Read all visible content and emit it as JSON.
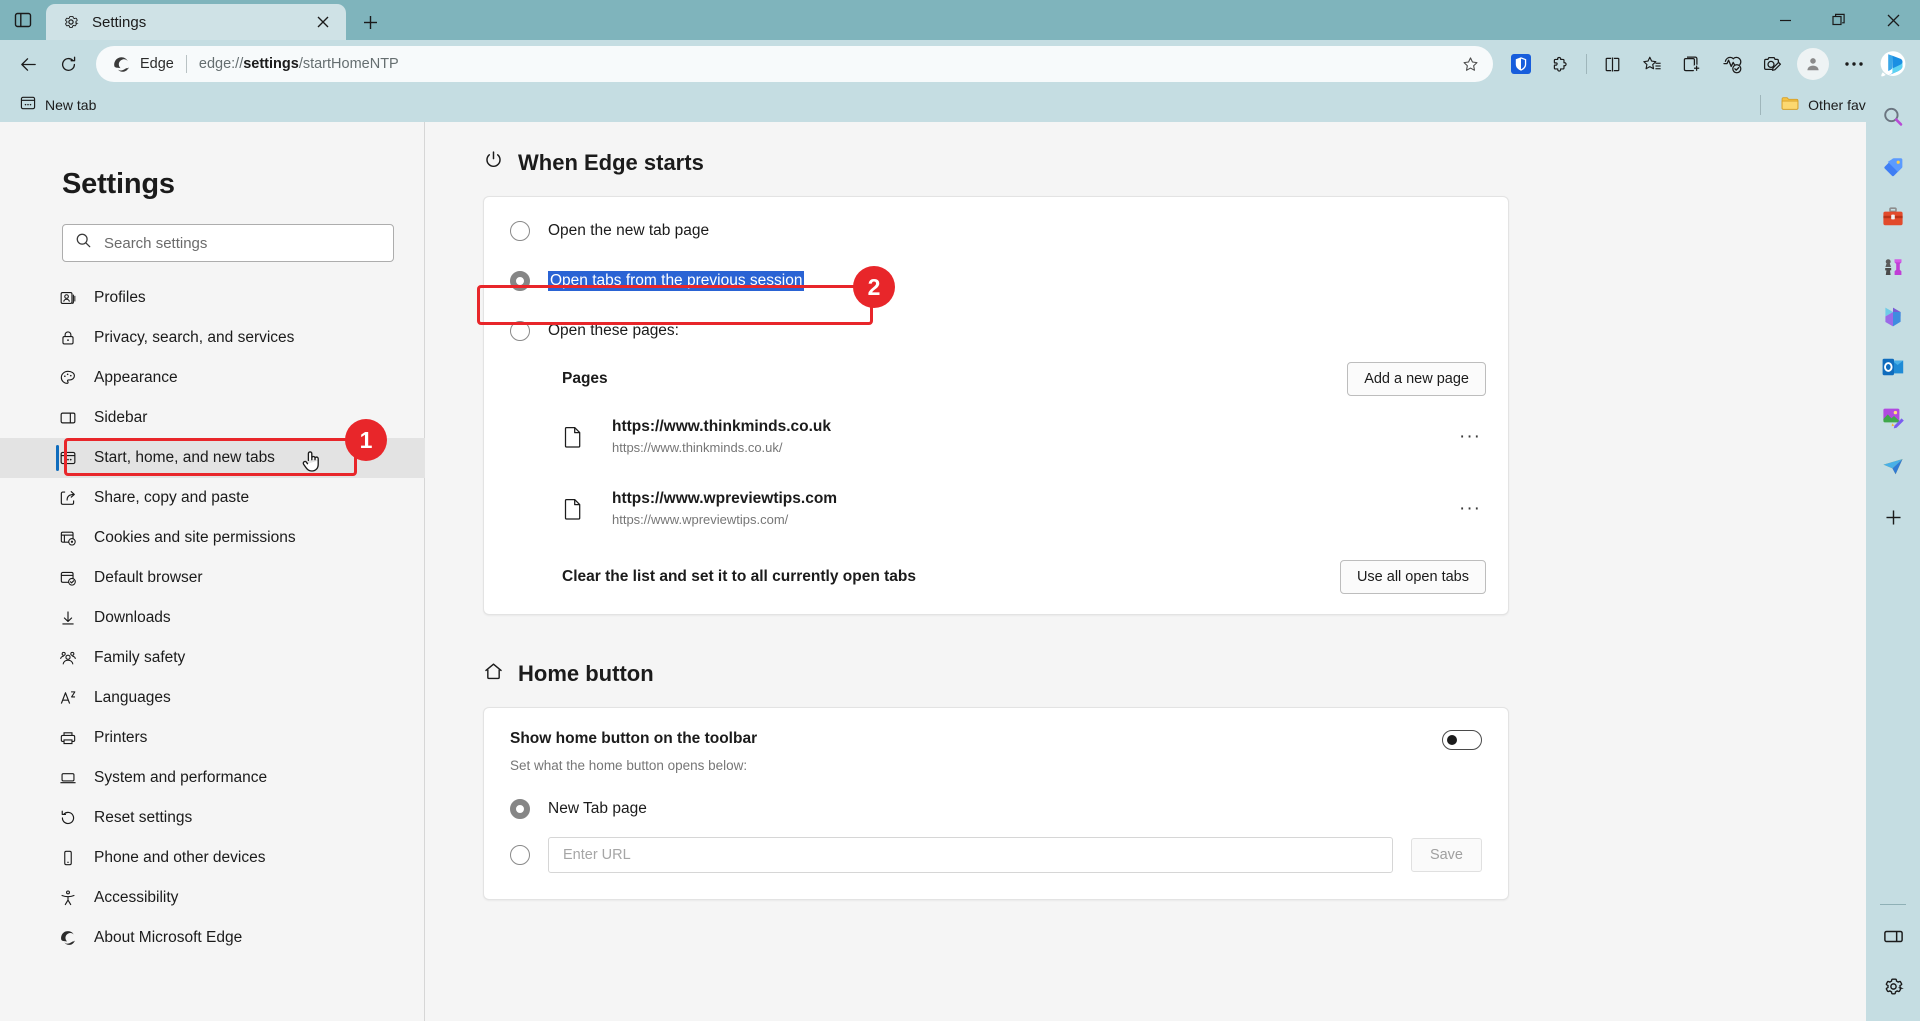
{
  "window": {
    "titlebar": {
      "tab_search_icon": "tab-search-icon",
      "tabs": [
        {
          "favicon": "gear-icon",
          "title": "Settings",
          "close_icon": "close-icon"
        }
      ],
      "new_tab_icon": "plus-icon",
      "controls": {
        "minimize": "minimize-icon",
        "maximize": "maximize-icon",
        "close": "close-icon"
      }
    },
    "toolbar": {
      "back_icon": "back-arrow-icon",
      "refresh_icon": "refresh-icon",
      "edge_label": "Edge",
      "url_prefix": "edge://",
      "url_bold": "settings",
      "url_suffix": "/startHomeNTP",
      "favorite_icon": "star-outline-icon",
      "right_icons": [
        "bitwarden-extension-icon",
        "extensions-puzzle-icon",
        "split-screen-icon",
        "favorites-star-list-icon",
        "collections-icon",
        "browser-essentials-icon",
        "screenshot-icon"
      ],
      "profile_icon": "profile-avatar-icon",
      "more_icon": "more-options-icon",
      "copilot_icon": "copilot-bing-icon"
    },
    "favorites_bar": {
      "items": [
        {
          "icon": "new-tab-icon",
          "label": "New tab"
        }
      ],
      "other_favorites": {
        "icon": "folder-icon",
        "label": "Other favorites"
      }
    }
  },
  "settings_nav": {
    "title": "Settings",
    "search": {
      "icon": "search-icon",
      "placeholder": "Search settings"
    },
    "items": [
      {
        "icon": "profiles-icon",
        "label": "Profiles",
        "selected": false
      },
      {
        "icon": "lock-icon",
        "label": "Privacy, search, and services",
        "selected": false
      },
      {
        "icon": "palette-icon",
        "label": "Appearance",
        "selected": false
      },
      {
        "icon": "sidebar-icon",
        "label": "Sidebar",
        "selected": false
      },
      {
        "icon": "start-home-icon",
        "label": "Start, home, and new tabs",
        "selected": true
      },
      {
        "icon": "share-icon",
        "label": "Share, copy and paste",
        "selected": false
      },
      {
        "icon": "cookies-icon",
        "label": "Cookies and site permissions",
        "selected": false
      },
      {
        "icon": "default-browser-icon",
        "label": "Default browser",
        "selected": false
      },
      {
        "icon": "download-icon",
        "label": "Downloads",
        "selected": false
      },
      {
        "icon": "family-icon",
        "label": "Family safety",
        "selected": false
      },
      {
        "icon": "languages-icon",
        "label": "Languages",
        "selected": false
      },
      {
        "icon": "printer-icon",
        "label": "Printers",
        "selected": false
      },
      {
        "icon": "laptop-icon",
        "label": "System and performance",
        "selected": false
      },
      {
        "icon": "reset-icon",
        "label": "Reset settings",
        "selected": false
      },
      {
        "icon": "phone-icon",
        "label": "Phone and other devices",
        "selected": false
      },
      {
        "icon": "accessibility-icon",
        "label": "Accessibility",
        "selected": false
      },
      {
        "icon": "edge-logo-icon",
        "label": "About Microsoft Edge",
        "selected": false
      }
    ]
  },
  "main": {
    "when_edge_starts": {
      "icon": "power-icon",
      "title": "When Edge starts",
      "options": [
        {
          "label": "Open the new tab page",
          "checked": false,
          "highlighted": false
        },
        {
          "label": "Open tabs from the previous session",
          "checked": true,
          "highlighted": true
        },
        {
          "label": "Open these pages:",
          "checked": false,
          "highlighted": false
        }
      ],
      "pages_label": "Pages",
      "add_page_button": "Add a new page",
      "pages": [
        {
          "icon": "document-icon",
          "name": "https://www.thinkminds.co.uk",
          "url": "https://www.thinkminds.co.uk/",
          "menu": "···"
        },
        {
          "icon": "document-icon",
          "name": "https://www.wpreviewtips.com",
          "url": "https://www.wpreviewtips.com/",
          "menu": "···"
        }
      ],
      "clear_label": "Clear the list and set it to all currently open tabs",
      "use_all_tabs_button": "Use all open tabs"
    },
    "home_button": {
      "icon": "home-icon",
      "title": "Home button",
      "toggle_label": "Show home button on the toolbar",
      "toggle_on": false,
      "sub_label": "Set what the home button opens below:",
      "options": [
        {
          "label": "New Tab page",
          "checked": true
        },
        {
          "label": "",
          "checked": false
        }
      ],
      "url_placeholder": "Enter URL",
      "url_value": "",
      "save_button": "Save"
    }
  },
  "edge_sidebar": {
    "icons": [
      "search-magnifier-icon",
      "shopping-tag-icon",
      "tools-toolbox-icon",
      "games-chess-icon",
      "office-icon",
      "outlook-icon",
      "image-creator-icon",
      "drop-send-icon",
      "add-plus-icon"
    ],
    "bottom_icons": [
      "sidebar-toggle-icon",
      "settings-gear-icon"
    ]
  },
  "annotations": [
    {
      "number": "1",
      "target": "sidebar-item-start-home-and-new-tabs"
    },
    {
      "number": "2",
      "target": "radio-open-tabs-from-previous-session"
    }
  ],
  "colors": {
    "accent_blue": "#0f6cbd",
    "selection_blue": "#2a63d4",
    "annotation_red": "#e8262a",
    "chrome_teal": "#c5dde2",
    "titlebar_teal": "#7fb4bc"
  }
}
